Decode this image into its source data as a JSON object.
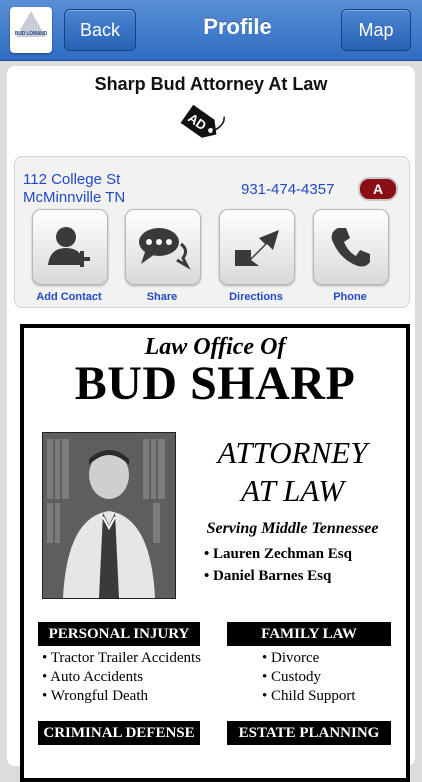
{
  "navbar": {
    "logo_text": "BUD LOMAND",
    "back_label": "Back",
    "title": "Profile",
    "map_label": "Map"
  },
  "business": {
    "name": "Sharp Bud Attorney At Law",
    "ad_tag": "AD"
  },
  "contact": {
    "address_line1": "112 College St",
    "address_line2": "McMinnville TN",
    "phone": "931-474-4357",
    "badge": "A"
  },
  "actions": [
    {
      "label": "Add Contact",
      "icon": "add-contact-icon"
    },
    {
      "label": "Share",
      "icon": "share-icon"
    },
    {
      "label": "Directions",
      "icon": "directions-icon"
    },
    {
      "label": "Phone",
      "icon": "phone-icon"
    }
  ],
  "advert": {
    "line1": "Law Office Of",
    "line2": "BUD SHARP",
    "attorney1": "ATTORNEY",
    "attorney2": "AT LAW",
    "serving": "Serving Middle Tennessee",
    "lawyers": [
      "• Lauren Zechman Esq",
      "• Daniel Barnes Esq"
    ],
    "personal_injury": {
      "title": "PERSONAL INJURY",
      "items": [
        "• Tractor Trailer Accidents",
        "• Auto Accidents",
        "• Wrongful Death"
      ]
    },
    "family_law": {
      "title": "FAMILY LAW",
      "items": [
        "• Divorce",
        "• Custody",
        "• Child Support"
      ]
    },
    "criminal_defense": {
      "title": "CRIMINAL DEFENSE"
    },
    "estate_planning": {
      "title": "ESTATE PLANNING"
    }
  },
  "colors": {
    "nav_blue": "#2f6cc2",
    "link_blue": "#2349c4",
    "badge_red": "#8a0f14"
  }
}
